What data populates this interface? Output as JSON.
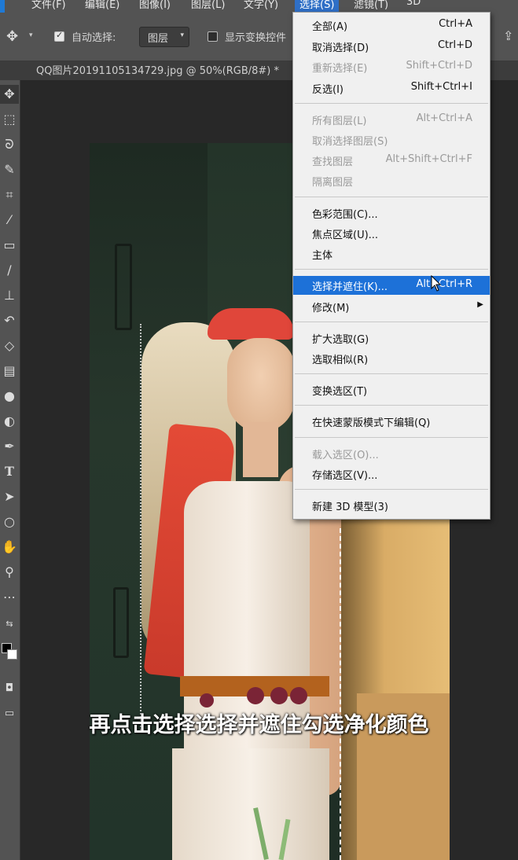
{
  "menubar": {
    "items": [
      {
        "label": "文件(F)"
      },
      {
        "label": "编辑(E)"
      },
      {
        "label": "图像(I)"
      },
      {
        "label": "图层(L)"
      },
      {
        "label": "文字(Y)"
      },
      {
        "label": "选择(S)"
      },
      {
        "label": "滤镜(T)"
      },
      {
        "label": "3D"
      }
    ],
    "active": "选择(S)"
  },
  "options": {
    "auto_select_label": "自动选择:",
    "auto_select_checked": true,
    "layer_select_value": "图层",
    "show_transform_label": "显示变换控件",
    "show_transform_checked": false
  },
  "document": {
    "tab_title": "QQ图片20191105134729.jpg @ 50%(RGB/8#) *"
  },
  "toolbar": {
    "tools": [
      "move-tool",
      "marquee-tool",
      "lasso-tool",
      "quick-select-tool",
      "crop-tool",
      "eyedropper-tool",
      "healing-brush-tool",
      "brush-tool",
      "clone-stamp-tool",
      "history-brush-tool",
      "eraser-tool",
      "gradient-tool",
      "blur-tool",
      "dodge-tool",
      "pen-tool",
      "type-tool",
      "path-select-tool",
      "shape-tool",
      "hand-tool",
      "zoom-tool",
      "more-tools",
      "swap-colors",
      "foreground-color",
      "quick-mask",
      "screen-mode"
    ],
    "foreground_color": "#000000",
    "background_color": "#ffffff"
  },
  "select_menu": {
    "items": [
      {
        "label": "全部(A)",
        "shortcut": "Ctrl+A",
        "enabled": true
      },
      {
        "label": "取消选择(D)",
        "shortcut": "Ctrl+D",
        "enabled": true
      },
      {
        "label": "重新选择(E)",
        "shortcut": "Shift+Ctrl+D",
        "enabled": false
      },
      {
        "label": "反选(I)",
        "shortcut": "Shift+Ctrl+I",
        "enabled": true
      },
      {
        "label": "所有图层(L)",
        "shortcut": "Alt+Ctrl+A",
        "enabled": false
      },
      {
        "label": "取消选择图层(S)",
        "shortcut": "",
        "enabled": false
      },
      {
        "label": "查找图层",
        "shortcut": "Alt+Shift+Ctrl+F",
        "enabled": false
      },
      {
        "label": "隔离图层",
        "shortcut": "",
        "enabled": false
      },
      {
        "label": "色彩范围(C)...",
        "shortcut": "",
        "enabled": true
      },
      {
        "label": "焦点区域(U)...",
        "shortcut": "",
        "enabled": true
      },
      {
        "label": "主体",
        "shortcut": "",
        "enabled": true
      },
      {
        "label": "选择并遮住(K)...",
        "shortcut": "Alt+Ctrl+R",
        "enabled": true,
        "highlighted": true
      },
      {
        "label": "修改(M)",
        "shortcut": "",
        "enabled": true,
        "submenu": true
      },
      {
        "label": "扩大选取(G)",
        "shortcut": "",
        "enabled": true
      },
      {
        "label": "选取相似(R)",
        "shortcut": "",
        "enabled": true
      },
      {
        "label": "变换选区(T)",
        "shortcut": "",
        "enabled": true
      },
      {
        "label": "在快速蒙版模式下编辑(Q)",
        "shortcut": "",
        "enabled": true
      },
      {
        "label": "载入选区(O)...",
        "shortcut": "",
        "enabled": false
      },
      {
        "label": "存储选区(V)...",
        "shortcut": "",
        "enabled": true
      },
      {
        "label": "新建 3D 模型(3)",
        "shortcut": "",
        "enabled": true
      }
    ]
  },
  "subtitle": "再点击选择选择并遮住勾选净化颜色",
  "colors": {
    "menu_highlight": "#1d71d8",
    "menubar_active": "#2f6fc6",
    "panel_bg": "#535353"
  }
}
